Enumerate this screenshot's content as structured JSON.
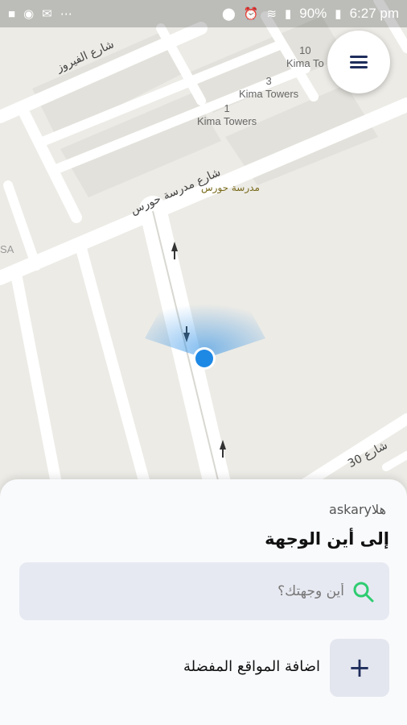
{
  "status_bar": {
    "time": "6:27 pm",
    "battery": "90%",
    "left_icons": [
      "square-icon",
      "messenger-icon",
      "mail-icon",
      "more-icon"
    ],
    "right_icons": [
      "location-icon",
      "alarm-icon",
      "wifi-icon",
      "signal-icon",
      "battery-icon"
    ]
  },
  "map": {
    "streets": [
      "شارع الفيروز",
      "شارع مدرسة حورس",
      "شارع 30"
    ],
    "places": [
      "10\nKima To",
      "3\nKima Towers",
      "1\nKima Towers"
    ],
    "poi": "مدرسة حورس",
    "edge_label": "SA",
    "user_dot_color": "#1e88e5"
  },
  "sheet": {
    "greeting": "askaryهلا",
    "title": "إلى أين الوجهة",
    "search": {
      "placeholder": "أين وجهتك؟"
    },
    "favorites": {
      "label": "اضافة المواقع المفضلة",
      "button": "+"
    }
  },
  "colors": {
    "accent": "#1f2d5c",
    "search_icon": "#2ecc71",
    "map_bg": "#ecebe6",
    "road": "#ffffff"
  }
}
